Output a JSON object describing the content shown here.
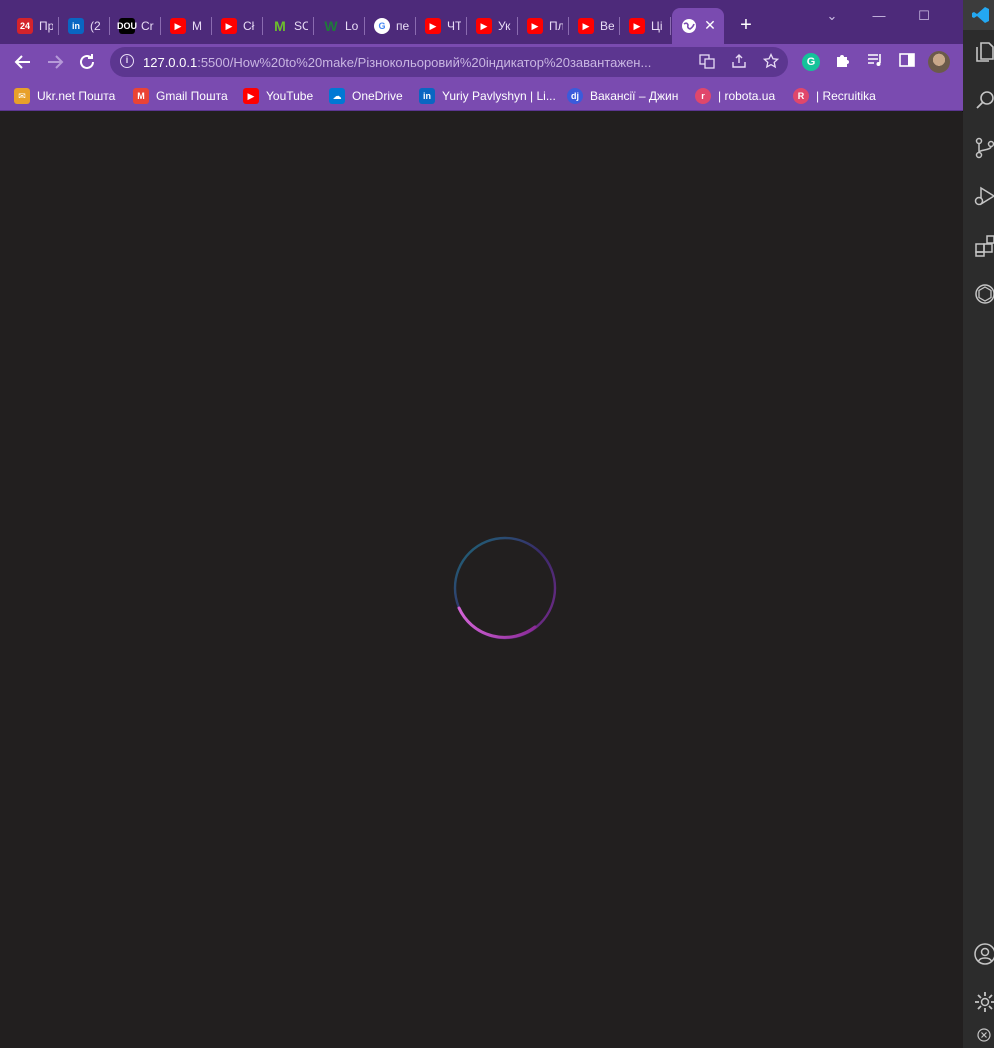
{
  "browser": {
    "tabs": [
      {
        "favicon_text": "24",
        "favicon_color": "#d4232b",
        "title": "Пр"
      },
      {
        "favicon_text": "in",
        "favicon_color": "#0a66c2",
        "title": "(2"
      },
      {
        "favicon_text": "DOU",
        "favicon_color": "#000000",
        "title": "Cr"
      },
      {
        "favicon_text": "▶",
        "favicon_color": "#ff0000",
        "title": "M"
      },
      {
        "favicon_text": "▶",
        "favicon_color": "#ff0000",
        "title": "Cł"
      },
      {
        "favicon_text": "M",
        "favicon_color": "#6cbf2c",
        "title": "SC"
      },
      {
        "favicon_text": "W",
        "favicon_color": "#1f7a3a",
        "title": "Lo"
      },
      {
        "favicon_text": "G",
        "favicon_color": "#ffffff",
        "title": "пе"
      },
      {
        "favicon_text": "▶",
        "favicon_color": "#ff0000",
        "title": "ЧТ"
      },
      {
        "favicon_text": "▶",
        "favicon_color": "#ff0000",
        "title": "Ук"
      },
      {
        "favicon_text": "▶",
        "favicon_color": "#ff0000",
        "title": "Пл"
      },
      {
        "favicon_text": "▶",
        "favicon_color": "#ff0000",
        "title": "Ве"
      },
      {
        "favicon_text": "▶",
        "favicon_color": "#ff0000",
        "title": "Ці"
      }
    ],
    "active_tab": {
      "icon": "globe-icon"
    },
    "new_tab_label": "+",
    "window_controls": {
      "collapse": "⌄",
      "minimize": "—",
      "maximize": "☐"
    },
    "url": {
      "host": "127.0.0.1",
      "rest": ":5500/How%20to%20make/Різнокольоровий%20індикатор%20завантажен..."
    },
    "bookmarks": [
      {
        "label": "Ukr.net Пошта",
        "icon": "ukrnet-icon",
        "color": "#e8a02a",
        "glyph": "✉"
      },
      {
        "label": "Gmail Пошта",
        "icon": "gmail-icon",
        "color": "#ea4335",
        "glyph": "M"
      },
      {
        "label": "YouTube",
        "icon": "youtube-icon",
        "color": "#ff0000",
        "glyph": "▶"
      },
      {
        "label": "OneDrive",
        "icon": "onedrive-icon",
        "color": "#0078d4",
        "glyph": "☁"
      },
      {
        "label": "Yuriy Pavlyshyn | Li...",
        "icon": "linkedin-icon",
        "color": "#0a66c2",
        "glyph": "in"
      },
      {
        "label": "Вакансії – Джин",
        "icon": "djinni-icon",
        "color": "#3b5bdb",
        "glyph": "dj"
      },
      {
        "label": "| robota.ua",
        "icon": "robota-icon",
        "color": "#e0476b",
        "glyph": "r"
      },
      {
        "label": "| Recruitika",
        "icon": "recruitika-icon",
        "color": "#e0476b",
        "glyph": "R"
      }
    ]
  },
  "colors": {
    "tabstrip": "#4d2a7a",
    "toolbar": "#7a4bb0",
    "page_background": "#221f1f",
    "loader_teal": "#1b6b78",
    "loader_purple": "#7a2a8c",
    "loader_pink": "#d263d6"
  }
}
